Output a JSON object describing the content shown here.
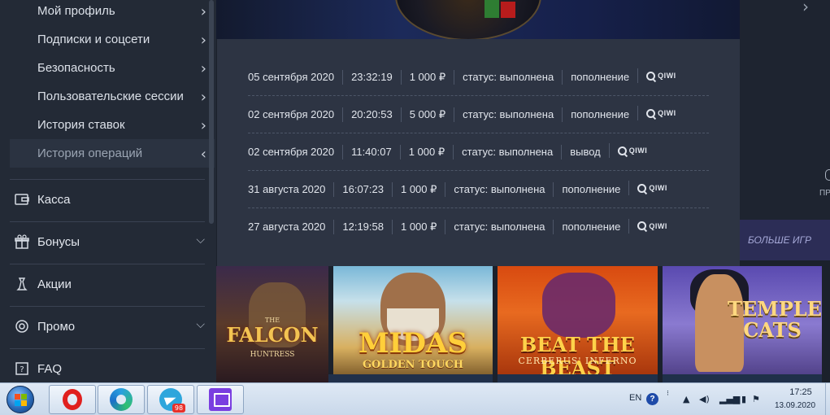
{
  "sidebar": {
    "sub_items": [
      {
        "label": "Мой профиль",
        "state": "collapsed"
      },
      {
        "label": "Подписки и соцсети",
        "state": "collapsed"
      },
      {
        "label": "Безопасность",
        "state": "collapsed"
      },
      {
        "label": "Пользовательские сессии",
        "state": "collapsed"
      },
      {
        "label": "История ставок",
        "state": "collapsed"
      },
      {
        "label": "История операций",
        "state": "active"
      }
    ],
    "menu_items": [
      {
        "label": "Касса",
        "icon": "wallet-icon"
      },
      {
        "label": "Бонусы",
        "icon": "gift-icon"
      },
      {
        "label": "Акции",
        "icon": "chess-icon"
      },
      {
        "label": "Промо",
        "icon": "promo-icon"
      },
      {
        "label": "FAQ",
        "icon": "question-icon"
      }
    ]
  },
  "operations": [
    {
      "date": "05 сентября 2020",
      "time": "23:32:19",
      "amount": "1 000 ₽",
      "status": "статус: выполнена",
      "type": "пополнение",
      "method": "QIWI"
    },
    {
      "date": "02 сентября 2020",
      "time": "20:20:53",
      "amount": "5 000 ₽",
      "status": "статус: выполнена",
      "type": "пополнение",
      "method": "QIWI"
    },
    {
      "date": "02 сентября 2020",
      "time": "11:40:07",
      "amount": "1 000 ₽",
      "status": "статус: выполнена",
      "type": "вывод",
      "method": "QIWI"
    },
    {
      "date": "31 августа 2020",
      "time": "16:07:23",
      "amount": "1 000 ₽",
      "status": "статус: выполнена",
      "type": "пополнение",
      "method": "QIWI"
    },
    {
      "date": "27 августа 2020",
      "time": "12:19:58",
      "amount": "1 000 ₽",
      "status": "статус: выполнена",
      "type": "пополнение",
      "method": "QIWI"
    }
  ],
  "right_panel": {
    "more_games": "БОЛЬШЕ ИГР",
    "pro_label": "ПРО"
  },
  "games": [
    {
      "title": "FALCON",
      "subtitle": "HUNTRESS",
      "prefix": "THE"
    },
    {
      "title": "MIDAS",
      "subtitle": "GOLDEN TOUCH"
    },
    {
      "title": "BEAT THE BEAST",
      "subtitle": "CERBERUS' INFERNO"
    },
    {
      "title": "TEMPLE CATS"
    }
  ],
  "taskbar": {
    "apps": [
      "opera-icon",
      "edge-icon",
      "telegram-icon",
      "twitch-icon"
    ],
    "telegram_badge": "98",
    "language": "EN",
    "time": "17:25",
    "date": "13.09.2020"
  },
  "colors": {
    "panel_bg": "#2d3443",
    "sidebar_bg": "#232a36",
    "more_games_bg": "#2c2d56"
  }
}
